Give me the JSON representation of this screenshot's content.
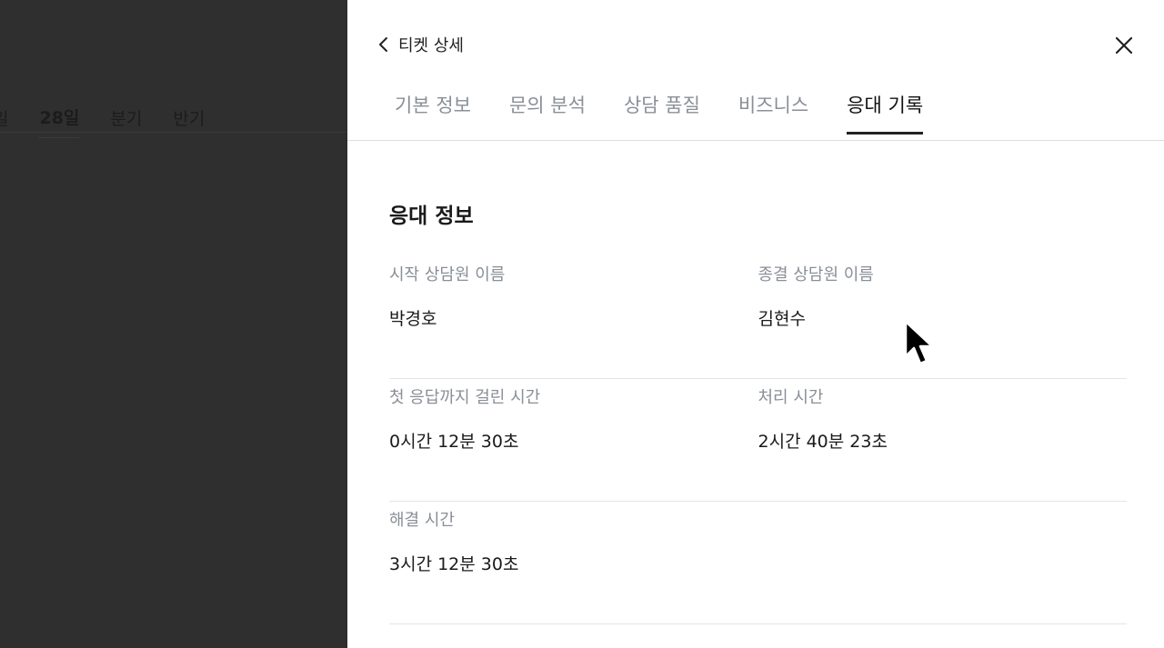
{
  "background": {
    "period_tabs": [
      {
        "label": "일",
        "active": false
      },
      {
        "label": "28일",
        "active": true
      },
      {
        "label": "분기",
        "active": false
      },
      {
        "label": "반기",
        "active": false
      }
    ]
  },
  "panel": {
    "title": "티켓 상세",
    "back_icon": "chevron-left-icon",
    "close_icon": "close-icon",
    "tabs": [
      {
        "label": "기본 정보",
        "active": false
      },
      {
        "label": "문의 분석",
        "active": false
      },
      {
        "label": "상담 품질",
        "active": false
      },
      {
        "label": "비즈니스",
        "active": false
      },
      {
        "label": "응대 기록",
        "active": true
      }
    ],
    "section_title": "응대 정보",
    "fields": [
      [
        {
          "label": "시작 상담원 이름",
          "value": "박경호"
        },
        {
          "label": "종결 상담원 이름",
          "value": "김현수"
        }
      ],
      [
        {
          "label": "첫 응답까지 걸린 시간",
          "value": "0시간 12분 30초"
        },
        {
          "label": "처리 시간",
          "value": "2시간 40분 23초"
        }
      ],
      [
        {
          "label": "해결 시간",
          "value": "3시간 12분 30초"
        }
      ]
    ]
  },
  "colors": {
    "overlay": "#2f2f2f",
    "active_text": "#111111",
    "muted_text": "#8a8f96"
  }
}
